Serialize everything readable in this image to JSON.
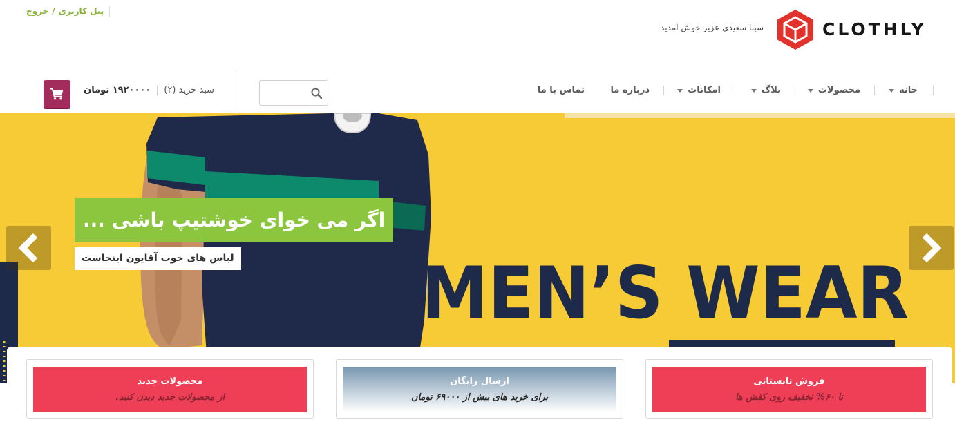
{
  "header": {
    "brand_name": "CLOTHLY",
    "logo_icon": "hexagon-cube-logo-icon",
    "welcome_text": "سینا سعیدی عزیز خوش آمدید",
    "user_links": {
      "panel_label": "پنل کاربری",
      "separator": "/",
      "logout_label": "خروج"
    }
  },
  "nav": {
    "dropdown_icon": "caret-down-icon",
    "items": [
      {
        "label": "خانه",
        "has_dropdown": true
      },
      {
        "label": "محصولات",
        "has_dropdown": true
      },
      {
        "label": "بلاگ",
        "has_dropdown": true
      },
      {
        "label": "امکانات",
        "has_dropdown": true
      },
      {
        "label": "درباره ما",
        "has_dropdown": false
      },
      {
        "label": "تماس با ما",
        "has_dropdown": false
      }
    ]
  },
  "search": {
    "icon": "search-icon"
  },
  "cart": {
    "label": "سبد خرید (۲)",
    "total": "۱۹۲۰۰۰۰ تومان",
    "icon": "cart-icon"
  },
  "hero": {
    "heading": "اگر می خوای خوشتیپ باشی ...",
    "subheading": "لباس های خوب آقایون اینجاست",
    "image_text": "MEN’S WEAR",
    "prev_icon": "chevron-left-icon",
    "next_icon": "chevron-right-icon"
  },
  "features": [
    {
      "title": "فروش تابستانی",
      "subtitle": "تا ۶۰% تخفیف روی کفش ها"
    },
    {
      "title": "ارسال رایگان",
      "subtitle": "برای خرید های بیش از ۶۹۰۰۰ تومان"
    },
    {
      "title": "محصولات جدید",
      "subtitle": "از محصولات جدید دیدن کنید."
    }
  ],
  "colors": {
    "brand_red": "#e2322c",
    "link_green": "#8ab43c",
    "accent_green": "#8cc63f",
    "promo_red": "#ef3f56",
    "cart_button": "#a22c5b",
    "hero_yellow": "#f6cb36",
    "hero_navy": "#1e2a4a"
  }
}
